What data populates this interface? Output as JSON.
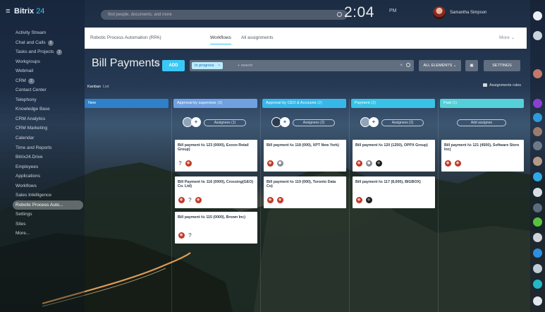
{
  "brand": {
    "name": "Bitrix",
    "suffix": "24"
  },
  "sidebar": {
    "items": [
      {
        "label": "Activity Stream"
      },
      {
        "label": "Chat and Calls",
        "count": "8"
      },
      {
        "label": "Tasks and Projects",
        "count": "3"
      },
      {
        "label": "Workgroups"
      },
      {
        "label": "Webmail"
      },
      {
        "label": "CRM",
        "count": "2"
      },
      {
        "label": "Contact Center"
      },
      {
        "label": "Telephony"
      },
      {
        "label": "Knowledge Base"
      },
      {
        "label": "CRM Analytics"
      },
      {
        "label": "CRM Marketing"
      },
      {
        "label": "Calendar"
      },
      {
        "label": "Time and Reports"
      },
      {
        "label": "Bitrix24.Drive"
      },
      {
        "label": "Employees"
      },
      {
        "label": "Applications"
      },
      {
        "label": "Workflows"
      },
      {
        "label": "Sales Intelligence"
      },
      {
        "label": "Robotic Process Auto...",
        "active": true
      },
      {
        "label": "Settings"
      },
      {
        "label": "Sites"
      },
      {
        "label": "More..."
      }
    ]
  },
  "header": {
    "search_placeholder": "find people, documents, and more",
    "clock": "2:04",
    "clock_sub": "PM",
    "user_name": "Samantha Simpson"
  },
  "tabs": [
    {
      "label": "Robotic Process Automation (RPA)",
      "active": false
    },
    {
      "label": "Workflows",
      "active": true
    },
    {
      "label": "All assignments",
      "active": false
    }
  ],
  "tabs_more": "More",
  "page": {
    "title": "Bill Payments",
    "add_button": "ADD",
    "filter_chip": "In progress",
    "filter_placeholder": "+ search",
    "buttons": {
      "all_elements": "ALL ELEMENTS",
      "settings": "SETTINGS"
    }
  },
  "view": {
    "kanban": "Kanban",
    "list": "List",
    "assignments": "Assignments rules"
  },
  "columns": [
    {
      "title": "New",
      "count": "",
      "color": "#2f80c8",
      "tools": null,
      "cards": []
    },
    {
      "title": "Approval by supervisor",
      "count": "(3)",
      "color": "#6fa0e0",
      "tools": {
        "pill": "Assignees (1)"
      },
      "cards": [
        {
          "title": "Bill payment № 123 (0000), Exxon Retail Group)",
          "icons": [
            "q",
            "red"
          ]
        },
        {
          "title": "Bill Payment № 116 (0000), Crossing(GEO) Co. Ltd)",
          "icons": [
            "red",
            "q",
            "red"
          ]
        },
        {
          "title": "Bill payment № 115 (0000), Brown Inc)",
          "icons": [
            "red",
            "q"
          ]
        }
      ]
    },
    {
      "title": "Approval by CEO & Accounts",
      "count": "(2)",
      "color": "#38b6e8",
      "tools": {
        "pill": "Assignees (2)"
      },
      "cards": [
        {
          "title": "Bill payment № 118 (000), XPT New York)",
          "icons": [
            "red",
            "gray"
          ]
        },
        {
          "title": "Bill payment № 119 (000), Toronto Data Co)",
          "icons": [
            "red",
            "red"
          ]
        }
      ]
    },
    {
      "title": "Payment",
      "count": "(2)",
      "color": "#39c2e6",
      "tools": {
        "pill": "Assignees (2)"
      },
      "cards": [
        {
          "title": "Bill payment № 120 (1250), OPPX Group)",
          "icons": [
            "red",
            "gray",
            "dark"
          ]
        },
        {
          "title": "Bill payment № 117 (8,000), BIGBOX)",
          "icons": [
            "red",
            "dark"
          ]
        }
      ]
    },
    {
      "title": "Paid",
      "count": "(1)",
      "color": "#55d0d8",
      "tools": {
        "pill": "Add assignee"
      },
      "cards": [
        {
          "title": "Bill payment № 121 (4500), Software Store Inc)",
          "icons": [
            "red",
            "red"
          ]
        }
      ]
    }
  ]
}
